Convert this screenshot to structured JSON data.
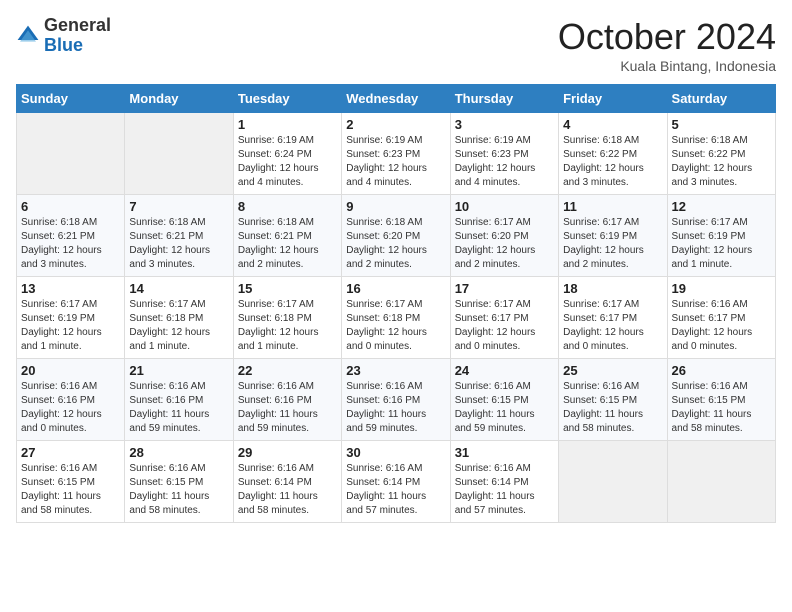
{
  "header": {
    "logo_line1": "General",
    "logo_line2": "Blue",
    "month": "October 2024",
    "location": "Kuala Bintang, Indonesia"
  },
  "weekdays": [
    "Sunday",
    "Monday",
    "Tuesday",
    "Wednesday",
    "Thursday",
    "Friday",
    "Saturday"
  ],
  "weeks": [
    [
      {
        "day": "",
        "info": ""
      },
      {
        "day": "",
        "info": ""
      },
      {
        "day": "1",
        "info": "Sunrise: 6:19 AM\nSunset: 6:24 PM\nDaylight: 12 hours\nand 4 minutes."
      },
      {
        "day": "2",
        "info": "Sunrise: 6:19 AM\nSunset: 6:23 PM\nDaylight: 12 hours\nand 4 minutes."
      },
      {
        "day": "3",
        "info": "Sunrise: 6:19 AM\nSunset: 6:23 PM\nDaylight: 12 hours\nand 4 minutes."
      },
      {
        "day": "4",
        "info": "Sunrise: 6:18 AM\nSunset: 6:22 PM\nDaylight: 12 hours\nand 3 minutes."
      },
      {
        "day": "5",
        "info": "Sunrise: 6:18 AM\nSunset: 6:22 PM\nDaylight: 12 hours\nand 3 minutes."
      }
    ],
    [
      {
        "day": "6",
        "info": "Sunrise: 6:18 AM\nSunset: 6:21 PM\nDaylight: 12 hours\nand 3 minutes."
      },
      {
        "day": "7",
        "info": "Sunrise: 6:18 AM\nSunset: 6:21 PM\nDaylight: 12 hours\nand 3 minutes."
      },
      {
        "day": "8",
        "info": "Sunrise: 6:18 AM\nSunset: 6:21 PM\nDaylight: 12 hours\nand 2 minutes."
      },
      {
        "day": "9",
        "info": "Sunrise: 6:18 AM\nSunset: 6:20 PM\nDaylight: 12 hours\nand 2 minutes."
      },
      {
        "day": "10",
        "info": "Sunrise: 6:17 AM\nSunset: 6:20 PM\nDaylight: 12 hours\nand 2 minutes."
      },
      {
        "day": "11",
        "info": "Sunrise: 6:17 AM\nSunset: 6:19 PM\nDaylight: 12 hours\nand 2 minutes."
      },
      {
        "day": "12",
        "info": "Sunrise: 6:17 AM\nSunset: 6:19 PM\nDaylight: 12 hours\nand 1 minute."
      }
    ],
    [
      {
        "day": "13",
        "info": "Sunrise: 6:17 AM\nSunset: 6:19 PM\nDaylight: 12 hours\nand 1 minute."
      },
      {
        "day": "14",
        "info": "Sunrise: 6:17 AM\nSunset: 6:18 PM\nDaylight: 12 hours\nand 1 minute."
      },
      {
        "day": "15",
        "info": "Sunrise: 6:17 AM\nSunset: 6:18 PM\nDaylight: 12 hours\nand 1 minute."
      },
      {
        "day": "16",
        "info": "Sunrise: 6:17 AM\nSunset: 6:18 PM\nDaylight: 12 hours\nand 0 minutes."
      },
      {
        "day": "17",
        "info": "Sunrise: 6:17 AM\nSunset: 6:17 PM\nDaylight: 12 hours\nand 0 minutes."
      },
      {
        "day": "18",
        "info": "Sunrise: 6:17 AM\nSunset: 6:17 PM\nDaylight: 12 hours\nand 0 minutes."
      },
      {
        "day": "19",
        "info": "Sunrise: 6:16 AM\nSunset: 6:17 PM\nDaylight: 12 hours\nand 0 minutes."
      }
    ],
    [
      {
        "day": "20",
        "info": "Sunrise: 6:16 AM\nSunset: 6:16 PM\nDaylight: 12 hours\nand 0 minutes."
      },
      {
        "day": "21",
        "info": "Sunrise: 6:16 AM\nSunset: 6:16 PM\nDaylight: 11 hours\nand 59 minutes."
      },
      {
        "day": "22",
        "info": "Sunrise: 6:16 AM\nSunset: 6:16 PM\nDaylight: 11 hours\nand 59 minutes."
      },
      {
        "day": "23",
        "info": "Sunrise: 6:16 AM\nSunset: 6:16 PM\nDaylight: 11 hours\nand 59 minutes."
      },
      {
        "day": "24",
        "info": "Sunrise: 6:16 AM\nSunset: 6:15 PM\nDaylight: 11 hours\nand 59 minutes."
      },
      {
        "day": "25",
        "info": "Sunrise: 6:16 AM\nSunset: 6:15 PM\nDaylight: 11 hours\nand 58 minutes."
      },
      {
        "day": "26",
        "info": "Sunrise: 6:16 AM\nSunset: 6:15 PM\nDaylight: 11 hours\nand 58 minutes."
      }
    ],
    [
      {
        "day": "27",
        "info": "Sunrise: 6:16 AM\nSunset: 6:15 PM\nDaylight: 11 hours\nand 58 minutes."
      },
      {
        "day": "28",
        "info": "Sunrise: 6:16 AM\nSunset: 6:15 PM\nDaylight: 11 hours\nand 58 minutes."
      },
      {
        "day": "29",
        "info": "Sunrise: 6:16 AM\nSunset: 6:14 PM\nDaylight: 11 hours\nand 58 minutes."
      },
      {
        "day": "30",
        "info": "Sunrise: 6:16 AM\nSunset: 6:14 PM\nDaylight: 11 hours\nand 57 minutes."
      },
      {
        "day": "31",
        "info": "Sunrise: 6:16 AM\nSunset: 6:14 PM\nDaylight: 11 hours\nand 57 minutes."
      },
      {
        "day": "",
        "info": ""
      },
      {
        "day": "",
        "info": ""
      }
    ]
  ]
}
